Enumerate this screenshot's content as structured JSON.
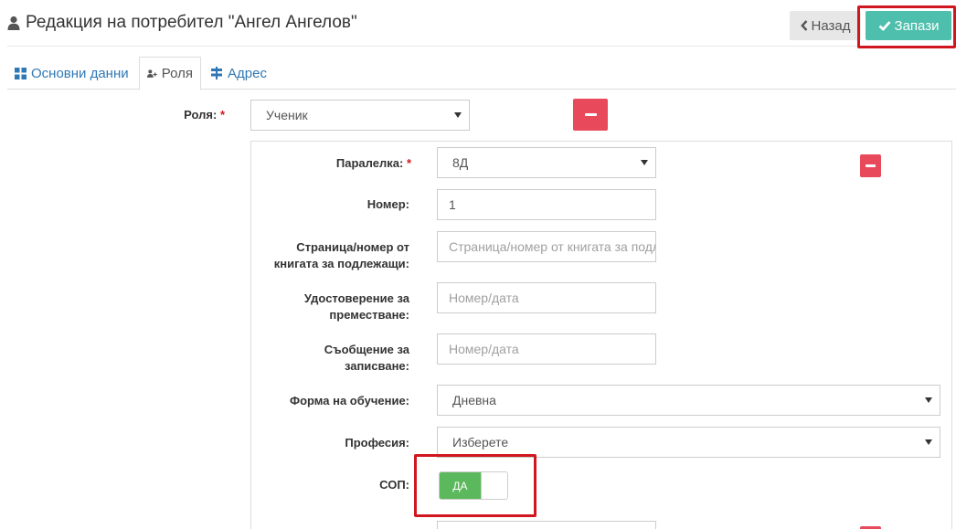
{
  "header": {
    "title": "Редакция на потребител \"Ангел Ангелов\"",
    "back_label": "Назад",
    "save_label": "Запази"
  },
  "tabs": [
    {
      "label": "Основни данни"
    },
    {
      "label": "Роля"
    },
    {
      "label": "Адрес"
    }
  ],
  "role": {
    "label": "Роля:",
    "required_mark": "*",
    "value": "Ученик"
  },
  "student": {
    "class": {
      "label": "Паралелка:",
      "required_mark": "*",
      "value": "8Д"
    },
    "number": {
      "label": "Номер:",
      "value": "1"
    },
    "registry_page": {
      "label": "Страница/номер от книгата за подлежащи:",
      "placeholder": "Страница/номер от книгата за подлежащи"
    },
    "transfer_certificate": {
      "label": "Удостоверение за преместване:",
      "placeholder": "Номер/дата"
    },
    "enrollment_notice": {
      "label": "Съобщение за записване:",
      "placeholder": "Номер/дата"
    },
    "education_form": {
      "label": "Форма на обучение:",
      "value": "Дневна"
    },
    "profession": {
      "label": "Професия:",
      "value": "Изберете"
    },
    "sop": {
      "label": "СОП:",
      "toggle_on_label": "ДА"
    }
  },
  "colors": {
    "save_button": "#4dbfac",
    "highlight_border": "#d0161f",
    "remove_button": "#e8495b",
    "toggle_on": "#5cb85c",
    "tab_link": "#2f78b5"
  },
  "icons": {
    "title": "user-icon",
    "back": "chevron-left-icon",
    "save": "checkmark-icon",
    "tab_basic": "grid-icon",
    "tab_role": "user-plus-icon",
    "tab_address": "signpost-icon",
    "remove": "minus-icon"
  }
}
